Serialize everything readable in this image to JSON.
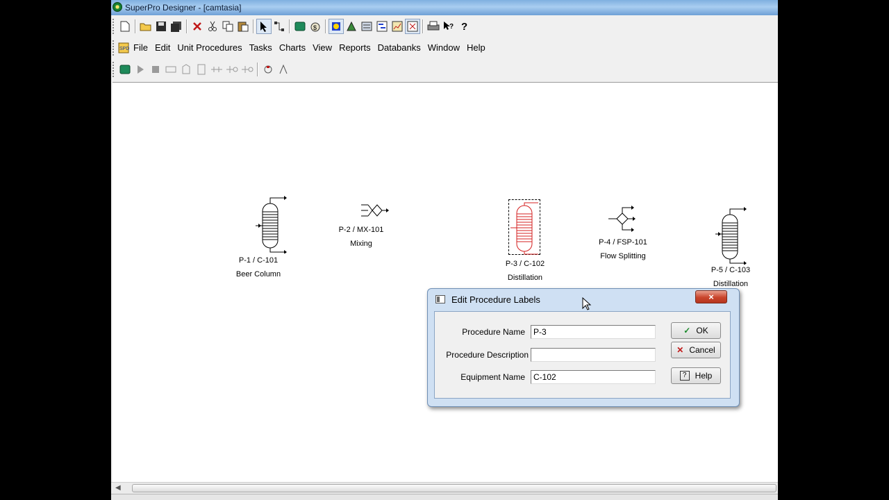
{
  "window": {
    "title": "SuperPro Designer - [camtasia]"
  },
  "menu": [
    "File",
    "Edit",
    "Unit Procedures",
    "Tasks",
    "Charts",
    "View",
    "Reports",
    "Databanks",
    "Window",
    "Help"
  ],
  "units": [
    {
      "id": "P-1 / C-101",
      "desc": "Beer Column"
    },
    {
      "id": "P-2 / MX-101",
      "desc": "Mixing"
    },
    {
      "id": "P-3 / C-102",
      "desc": "Distillation"
    },
    {
      "id": "P-4 / FSP-101",
      "desc": "Flow Splitting"
    },
    {
      "id": "P-5 / C-103",
      "desc": "Distillation"
    }
  ],
  "dialog": {
    "title": "Edit Procedure Labels",
    "close_label": "×",
    "fields": {
      "procedure_name": {
        "label": "Procedure Name",
        "value": "P-3"
      },
      "procedure_description": {
        "label": "Procedure Description",
        "value": ""
      },
      "equipment_name": {
        "label": "Equipment Name",
        "value": "C-102"
      }
    },
    "buttons": {
      "ok": "OK",
      "cancel": "Cancel",
      "help": "Help"
    }
  },
  "colors": {
    "selected_unit": "#d42020",
    "titlebar": "#a9cdf0",
    "close_button": "#c9452c"
  }
}
